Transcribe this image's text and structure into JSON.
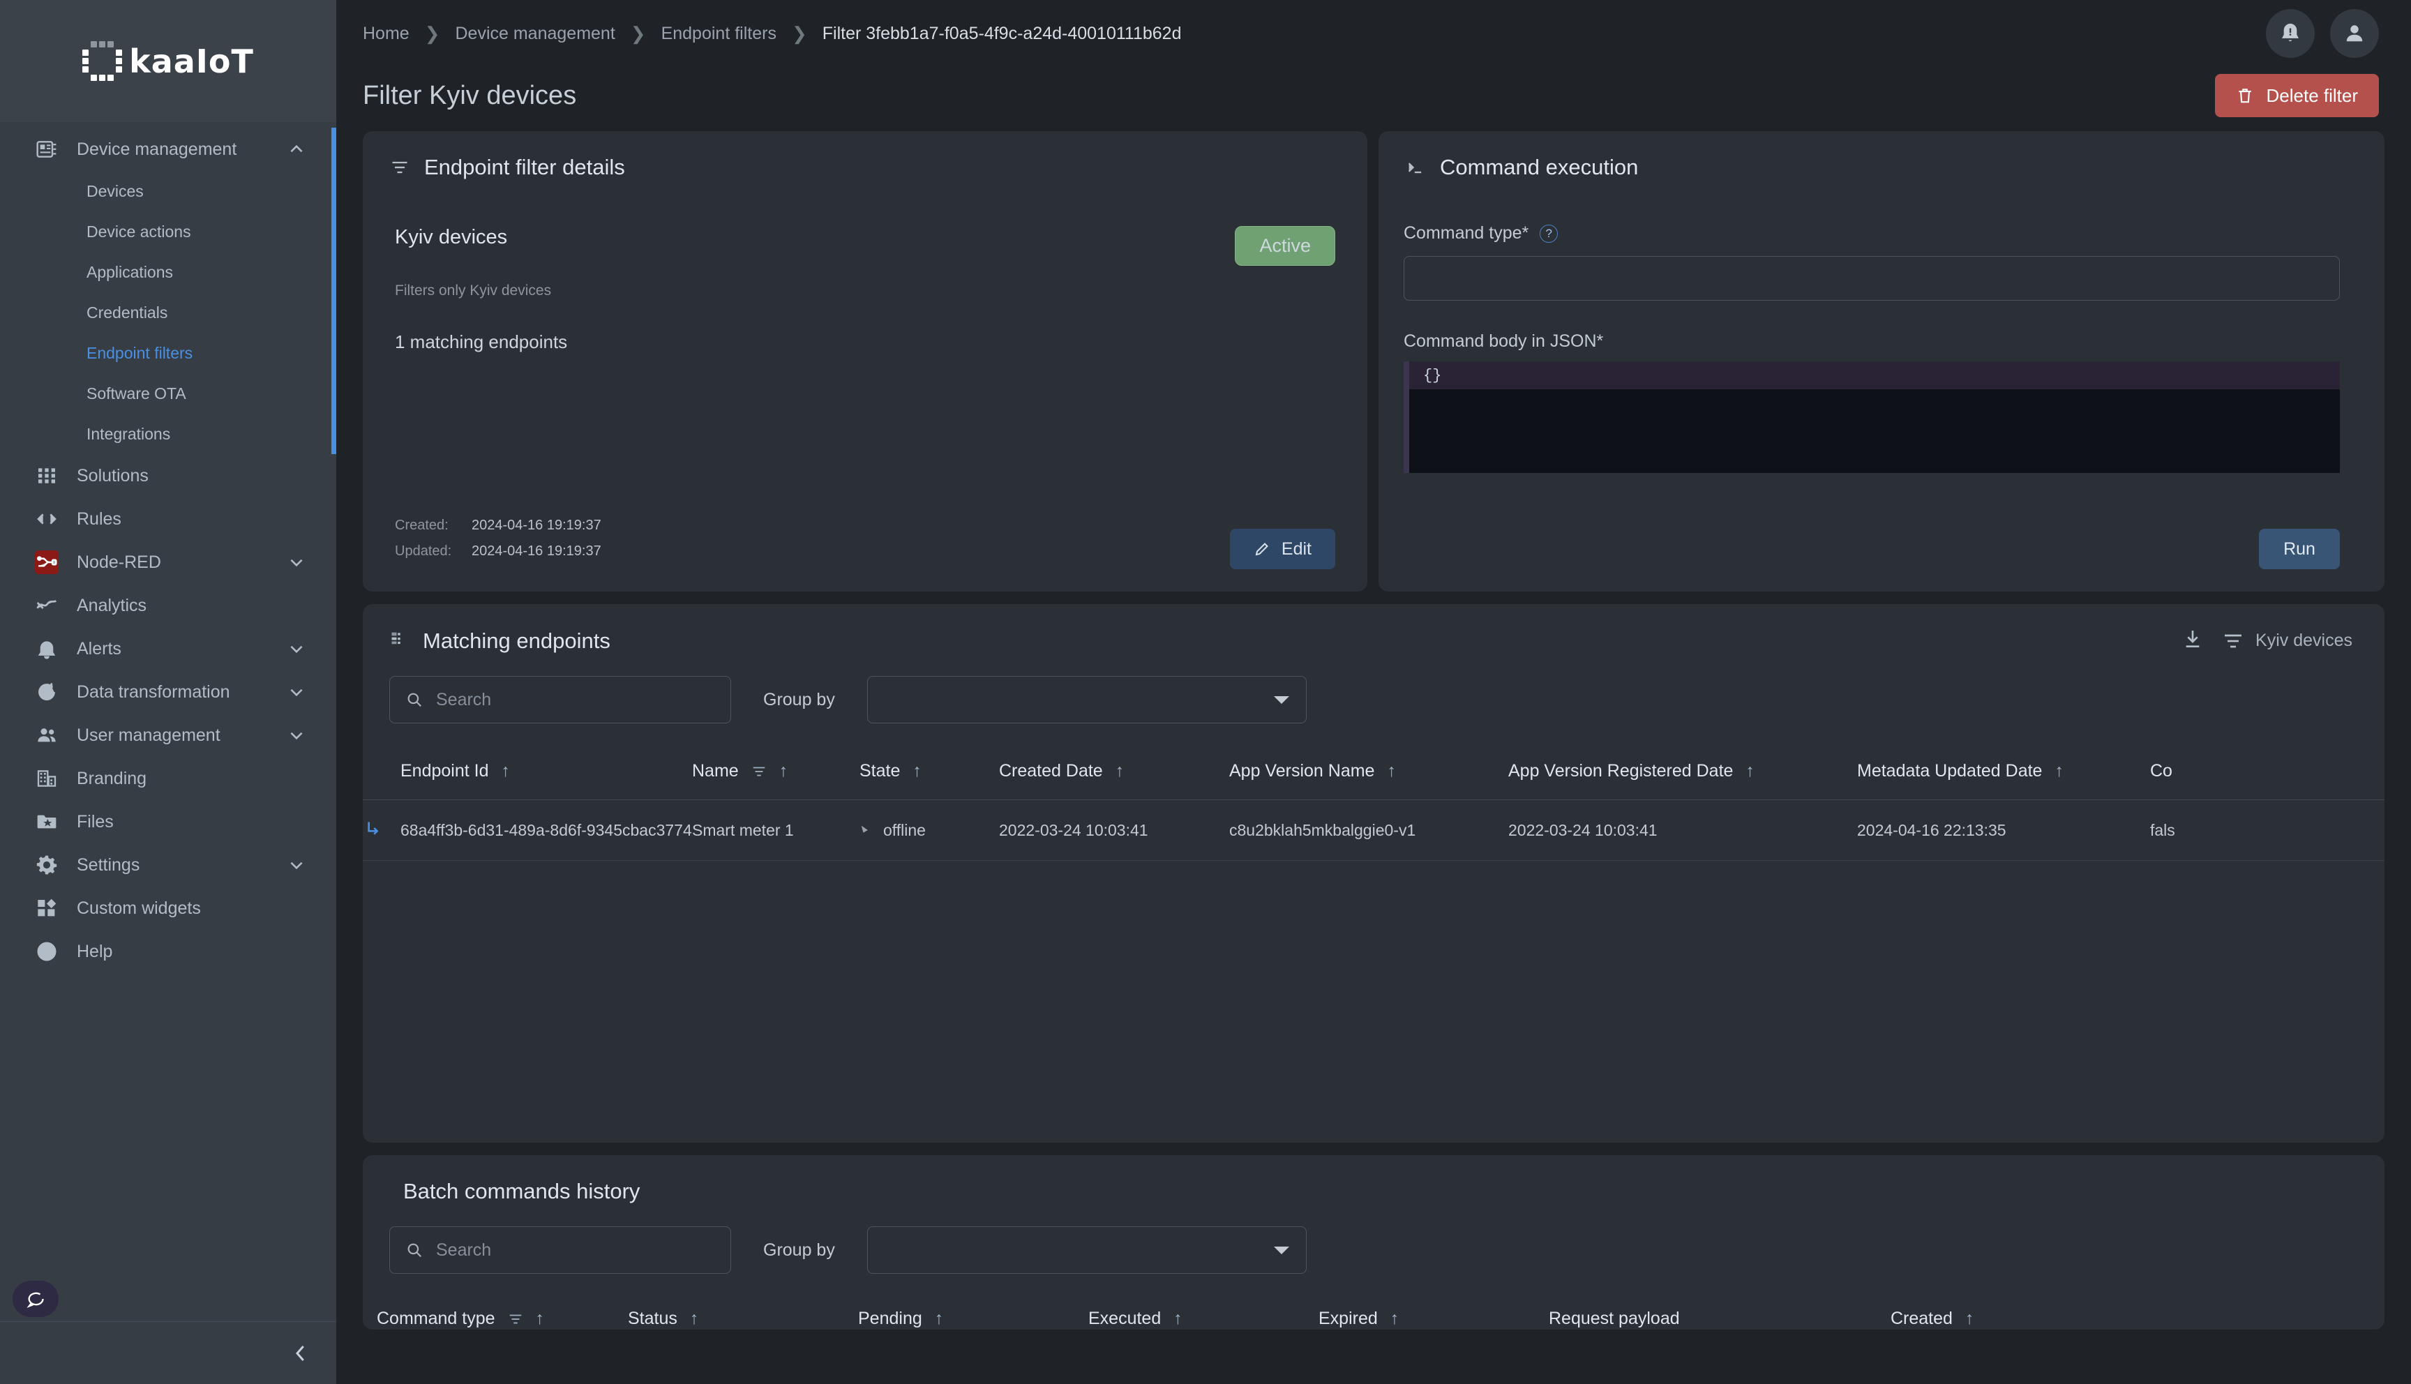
{
  "brand": {
    "name": "kaaIoT"
  },
  "sidebar": {
    "groups": [
      {
        "label": "Device management",
        "icon": "device-management-icon",
        "expanded": true,
        "children": [
          {
            "label": "Devices",
            "selected": false
          },
          {
            "label": "Device actions",
            "selected": false
          },
          {
            "label": "Applications",
            "selected": false
          },
          {
            "label": "Credentials",
            "selected": false
          },
          {
            "label": "Endpoint filters",
            "selected": true
          },
          {
            "label": "Software OTA",
            "selected": false
          },
          {
            "label": "Integrations",
            "selected": false
          }
        ]
      }
    ],
    "items": [
      {
        "label": "Solutions",
        "icon": "grid-icon",
        "chevron": false
      },
      {
        "label": "Rules",
        "icon": "code-icon",
        "chevron": false
      },
      {
        "label": "Node-RED",
        "icon": "node-red-icon",
        "chevron": true
      },
      {
        "label": "Analytics",
        "icon": "analytics-icon",
        "chevron": false
      },
      {
        "label": "Alerts",
        "icon": "bell-icon",
        "chevron": true
      },
      {
        "label": "Data transformation",
        "icon": "refresh-check-icon",
        "chevron": true
      },
      {
        "label": "User management",
        "icon": "users-icon",
        "chevron": true
      },
      {
        "label": "Branding",
        "icon": "building-icon",
        "chevron": false
      },
      {
        "label": "Files",
        "icon": "folder-star-icon",
        "chevron": false
      },
      {
        "label": "Settings",
        "icon": "gear-icon",
        "chevron": true
      },
      {
        "label": "Custom widgets",
        "icon": "widgets-icon",
        "chevron": false
      },
      {
        "label": "Help",
        "icon": "help-circle-icon",
        "chevron": false
      }
    ]
  },
  "breadcrumb": [
    "Home",
    "Device management",
    "Endpoint filters",
    "Filter 3febb1a7-f0a5-4f9c-a24d-40010111b62d"
  ],
  "page": {
    "title": "Filter Kyiv devices",
    "delete_label": "Delete filter"
  },
  "details": {
    "card_title": "Endpoint filter details",
    "name": "Kyiv devices",
    "status": "Active",
    "description": "Filters only Kyiv devices",
    "matching": "1 matching endpoints",
    "created_label": "Created:",
    "created_value": "2024-04-16 19:19:37",
    "updated_label": "Updated:",
    "updated_value": "2024-04-16 19:19:37",
    "edit_label": "Edit"
  },
  "command": {
    "card_title": "Command execution",
    "type_label": "Command type*",
    "type_value": "",
    "body_label": "Command body in JSON*",
    "body_value": "{}",
    "run_label": "Run"
  },
  "matching": {
    "card_title": "Matching endpoints",
    "filter_chip": "Kyiv devices",
    "search_placeholder": "Search",
    "search_value": "",
    "group_by_label": "Group by",
    "group_by_value": "",
    "columns": [
      "Endpoint Id",
      "Name",
      "State",
      "Created Date",
      "App Version Name",
      "App Version Registered Date",
      "Metadata Updated Date",
      "Co"
    ],
    "rows": [
      {
        "endpoint_id": "68a4ff3b-6d31-489a-8d6f-9345cbac3774",
        "name": "Smart meter 1",
        "state": "offline",
        "created_date": "2022-03-24 10:03:41",
        "app_version_name": "c8u2bklah5mkbalggie0-v1",
        "app_version_registered_date": "2022-03-24 10:03:41",
        "metadata_updated_date": "2024-04-16 22:13:35",
        "co": "fals"
      }
    ]
  },
  "batch": {
    "card_title": "Batch commands history",
    "search_placeholder": "Search",
    "search_value": "",
    "group_by_label": "Group by",
    "group_by_value": "",
    "columns": [
      "Command type",
      "Status",
      "Pending",
      "Executed",
      "Expired",
      "Request payload",
      "Created"
    ]
  },
  "colors": {
    "accent": "#4a90e2",
    "danger": "#b4514d",
    "active_badge": "#6fa173",
    "sidebar_bg": "#373d45",
    "card_bg": "#2b3036",
    "page_bg": "#1f2227"
  }
}
